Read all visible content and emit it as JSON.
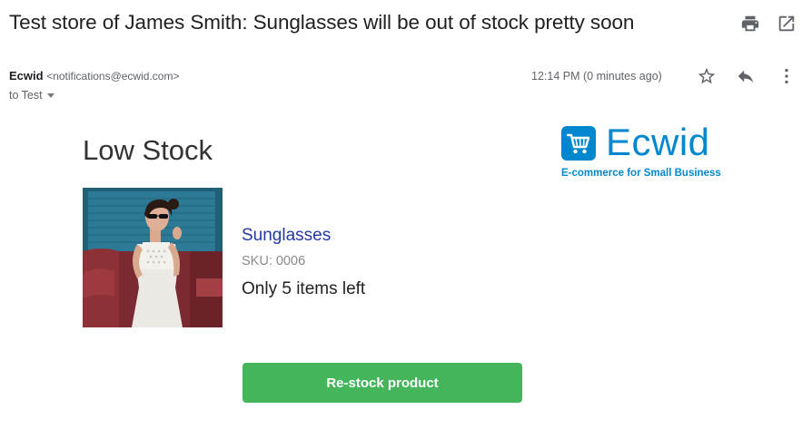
{
  "email": {
    "subject": "Test store of James Smith: Sunglasses will be out of stock pretty soon",
    "sender_name": "Ecwid",
    "sender_email": "<notifications@ecwid.com>",
    "recipient": "to Test",
    "timestamp": "12:14 PM (0 minutes ago)"
  },
  "toolbar": {
    "print_icon": "print-icon",
    "popout_icon": "open-in-new-window-icon",
    "star_icon": "star-icon",
    "reply_icon": "reply-icon",
    "more_icon": "more-vertical-icon"
  },
  "body": {
    "heading": "Low Stock",
    "logo": {
      "word": "Ecwid",
      "tagline": "E-commerce for Small Business",
      "icon": "shopping-cart-icon"
    },
    "product": {
      "name": "Sunglasses",
      "sku": "SKU: 0006",
      "stock_message": "Only 5 items left"
    },
    "restock_button": "Re-stock product"
  },
  "colors": {
    "brand": "#0087cd",
    "product_link": "#2339a3",
    "button": "#45b55c"
  }
}
